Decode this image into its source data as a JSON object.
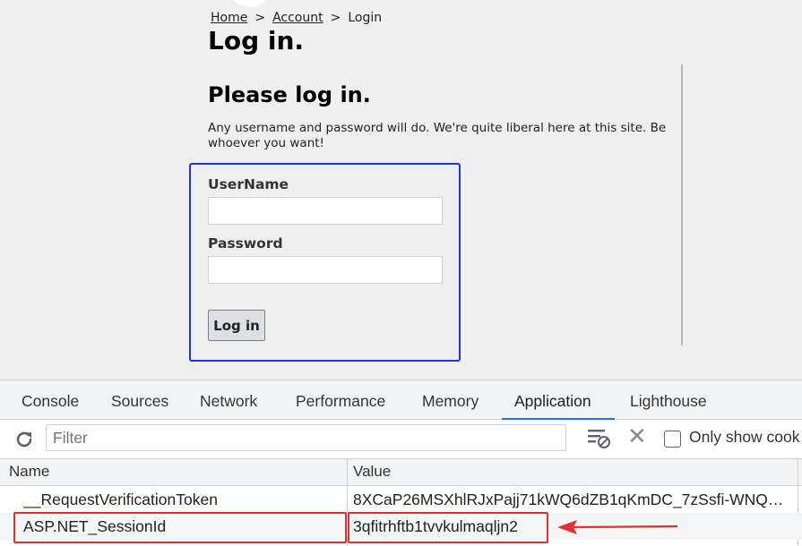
{
  "breadcrumb": {
    "home": "Home",
    "separator_1": ">",
    "account": "Account",
    "separator_2": ">",
    "current": "Login"
  },
  "page": {
    "title": "Log in.",
    "subtitle": "Please log in.",
    "intro": "Any username and password will do. We're quite liberal here at this site. Be whoever you want!"
  },
  "form": {
    "username_label": "UserName",
    "username_value": "",
    "password_label": "Password",
    "password_value": "",
    "submit_label": "Log in"
  },
  "devtools": {
    "tabs": [
      {
        "label": "Console"
      },
      {
        "label": "Sources"
      },
      {
        "label": "Network"
      },
      {
        "label": "Performance"
      },
      {
        "label": "Memory"
      },
      {
        "label": "Application",
        "active": true
      },
      {
        "label": "Lighthouse"
      }
    ],
    "toolbar": {
      "refresh_icon": "refresh-icon",
      "filter_placeholder": "Filter",
      "clear_filter_icon": "filter-clear-icon",
      "close_icon": "close-icon",
      "only_show_label": "Only show cook"
    },
    "table": {
      "columns": [
        "Name",
        "Value"
      ],
      "rows": [
        {
          "name": "__RequestVerificationToken",
          "value": "8XCaP26MSXhlRJxPajj71kWQ6dZB1qKmDC_7zSsfi-WNQ…"
        },
        {
          "name": "ASP.NET_SessionId",
          "value": "3qfitrhftb1tvvkulmaqljn2"
        }
      ]
    }
  },
  "colors": {
    "login_box_border": "#2233dd",
    "annotation_red": "#e03030",
    "active_tab_underline": "#1a73e8"
  }
}
